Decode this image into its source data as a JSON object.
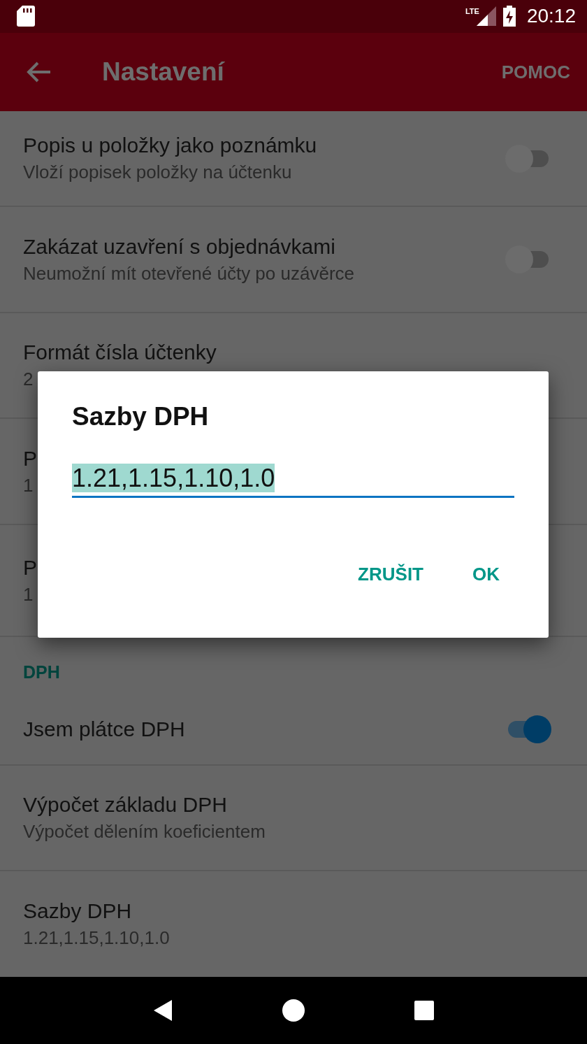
{
  "status_bar": {
    "network": "LTE",
    "time": "20:12"
  },
  "app_bar": {
    "title": "Nastavení",
    "action": "POMOC"
  },
  "settings": [
    {
      "kind": "switch",
      "title": "Popis u položky jako poznámku",
      "subtitle": "Vloží popisek položky na účtenku",
      "on": false
    },
    {
      "kind": "switch",
      "title": "Zakázat uzavření s objednávkami",
      "subtitle": "Neumožní mít otevřené účty po uzávěrce",
      "on": false
    },
    {
      "kind": "value",
      "title": "Formát čísla účtenky",
      "subtitle": "2"
    },
    {
      "kind": "value",
      "title": "P",
      "subtitle": "1"
    },
    {
      "kind": "value",
      "title": "P",
      "subtitle": "1"
    },
    {
      "kind": "header",
      "title": "DPH"
    },
    {
      "kind": "switch",
      "title": "Jsem plátce DPH",
      "on": true
    },
    {
      "kind": "value",
      "title": "Výpočet základu DPH",
      "subtitle": "Výpočet dělením koeficientem"
    },
    {
      "kind": "value",
      "title": "Sazby DPH",
      "subtitle": "1.21,1.15,1.10,1.0"
    }
  ],
  "dialog": {
    "title": "Sazby DPH",
    "value": "1.21,1.15,1.10,1.0",
    "text_selected": true,
    "buttons": [
      "ZRUŠIT",
      "OK"
    ]
  }
}
